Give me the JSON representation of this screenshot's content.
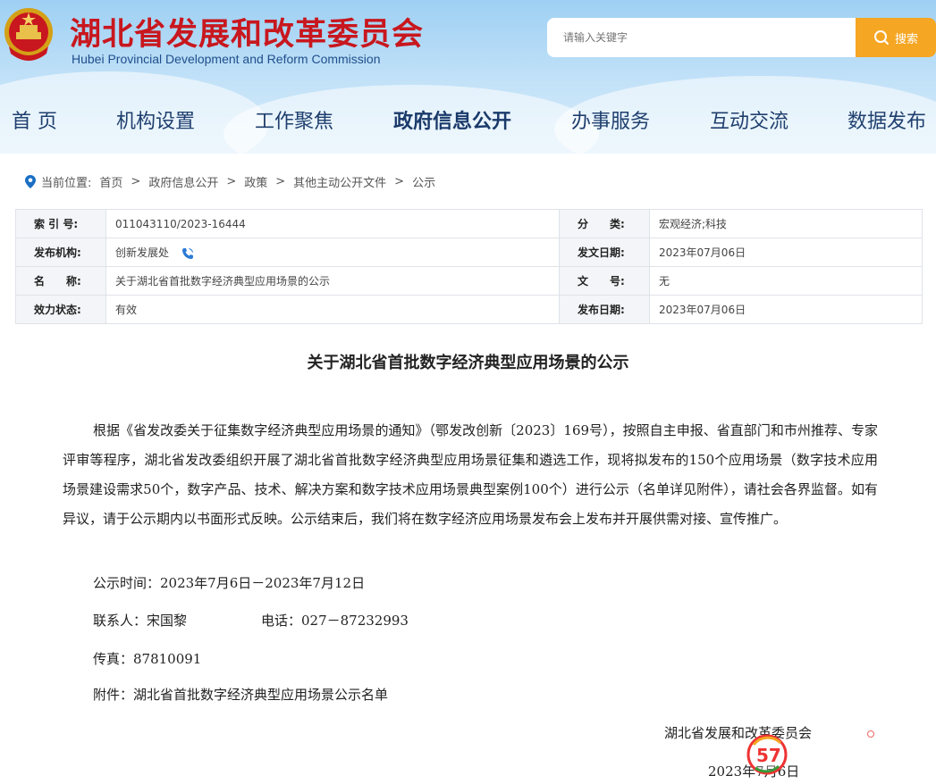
{
  "header": {
    "title": "湖北省发展和改革委员会",
    "subtitle": "Hubei Provincial Development and Reform Commission",
    "search_placeholder": "请输入关键字",
    "search_button": "搜索",
    "nav": [
      "首 页",
      "机构设置",
      "工作聚焦",
      "政府信息公开",
      "办事服务",
      "互动交流",
      "数据发布"
    ],
    "nav_active": "政府信息公开"
  },
  "breadcrumb": {
    "label": "当前位置:",
    "items": [
      "首页",
      "政府信息公开",
      "政策",
      "其他主动公开文件",
      "公示"
    ]
  },
  "info": {
    "index_label": "索 引 号:",
    "index_value": "011043110/2023-16444",
    "category_label": "分　　类:",
    "category_value": "宏观经济;科技",
    "org_label": "发布机构:",
    "org_value": "创新发展处",
    "date_label": "发文日期:",
    "date_value": "2023年07月06日",
    "name_label": "名　　称:",
    "name_value": "关于湖北省首批数字经济典型应用场景的公示",
    "docno_label": "文　　号:",
    "docno_value": "无",
    "status_label": "效力状态:",
    "status_value": "有效",
    "pubdate_label": "发布日期:",
    "pubdate_value": "2023年07月06日"
  },
  "article": {
    "title": "关于湖北省首批数字经济典型应用场景的公示",
    "body": "根据《省发改委关于征集数字经济典型应用场景的通知》（鄂发改创新〔2023〕169号），按照自主申报、省直部门和市州推荐、专家评审等程序，湖北省发改委组织开展了湖北省首批数字经济典型应用场景征集和遴选工作，现将拟发布的150个应用场景（数字技术应用场景建设需求50个，数字产品、技术、解决方案和数字技术应用场景典型案例100个）进行公示（名单详见附件），请社会各界监督。如有异议，请于公示期内以书面形式反映。公示结束后，我们将在数字经济应用场景发布会上发布并开展供需对接、宣传推广。",
    "period": "公示时间：2023年7月6日－2023年7月12日",
    "contact": "联系人：宋国黎",
    "phone": "电话：027－87232993",
    "fax": "传真：87810091",
    "attachment_label": "附件：",
    "attachment_link": "湖北省首批数字经济典型应用场景公示名单",
    "sign_org": "湖北省发展和改革委员会",
    "sign_date": "2023年7月6日"
  },
  "colors": {
    "brand_red": "#c8171e",
    "nav_blue": "#1f3f6e",
    "search_orange": "#f5a623"
  }
}
